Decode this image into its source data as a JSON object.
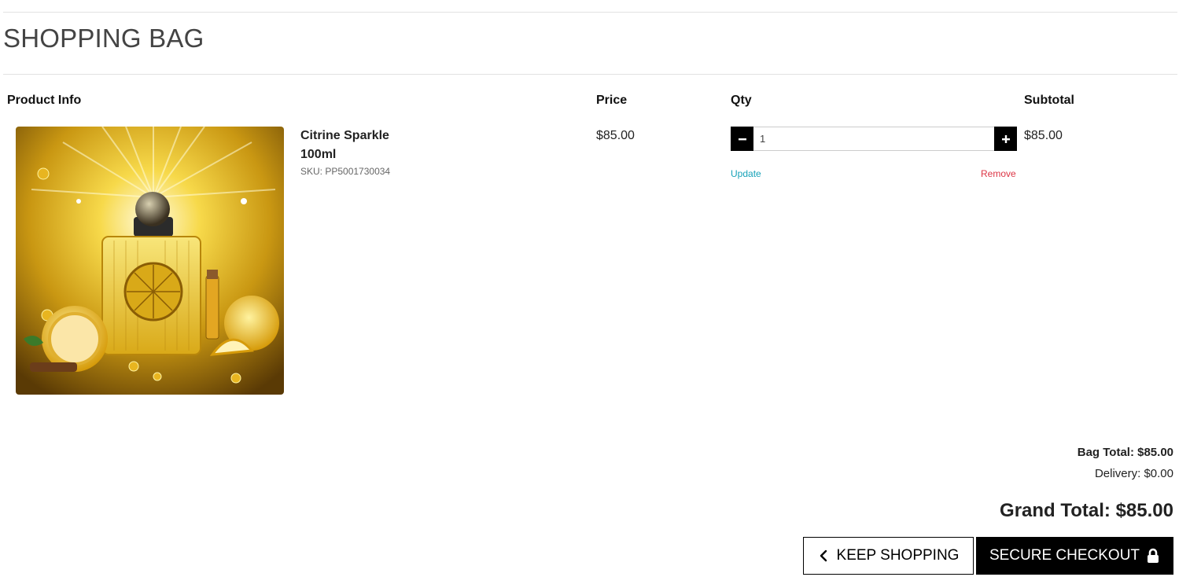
{
  "page": {
    "title": "SHOPPING BAG"
  },
  "table": {
    "headers": {
      "product_info": "Product Info",
      "price": "Price",
      "qty": "Qty",
      "subtotal": "Subtotal"
    },
    "items": [
      {
        "name": "Citrine Sparkle",
        "size": "100ml",
        "sku": "SKU: PP5001730034",
        "price": "$85.00",
        "qty_value": "1",
        "subtotal": "$85.00",
        "update_label": "Update",
        "remove_label": "Remove",
        "image_icon": "perfume-bottle-product-image"
      }
    ]
  },
  "summary": {
    "bag_total": "Bag Total: $85.00",
    "delivery": "Delivery: $0.00",
    "grand_total": "Grand Total: $85.00"
  },
  "actions": {
    "keep_shopping": "KEEP SHOPPING",
    "secure_checkout": "SECURE CHECKOUT"
  },
  "colors": {
    "update_link": "#17a2b8",
    "remove_link": "#dc3545",
    "button_dark": "#000000"
  }
}
